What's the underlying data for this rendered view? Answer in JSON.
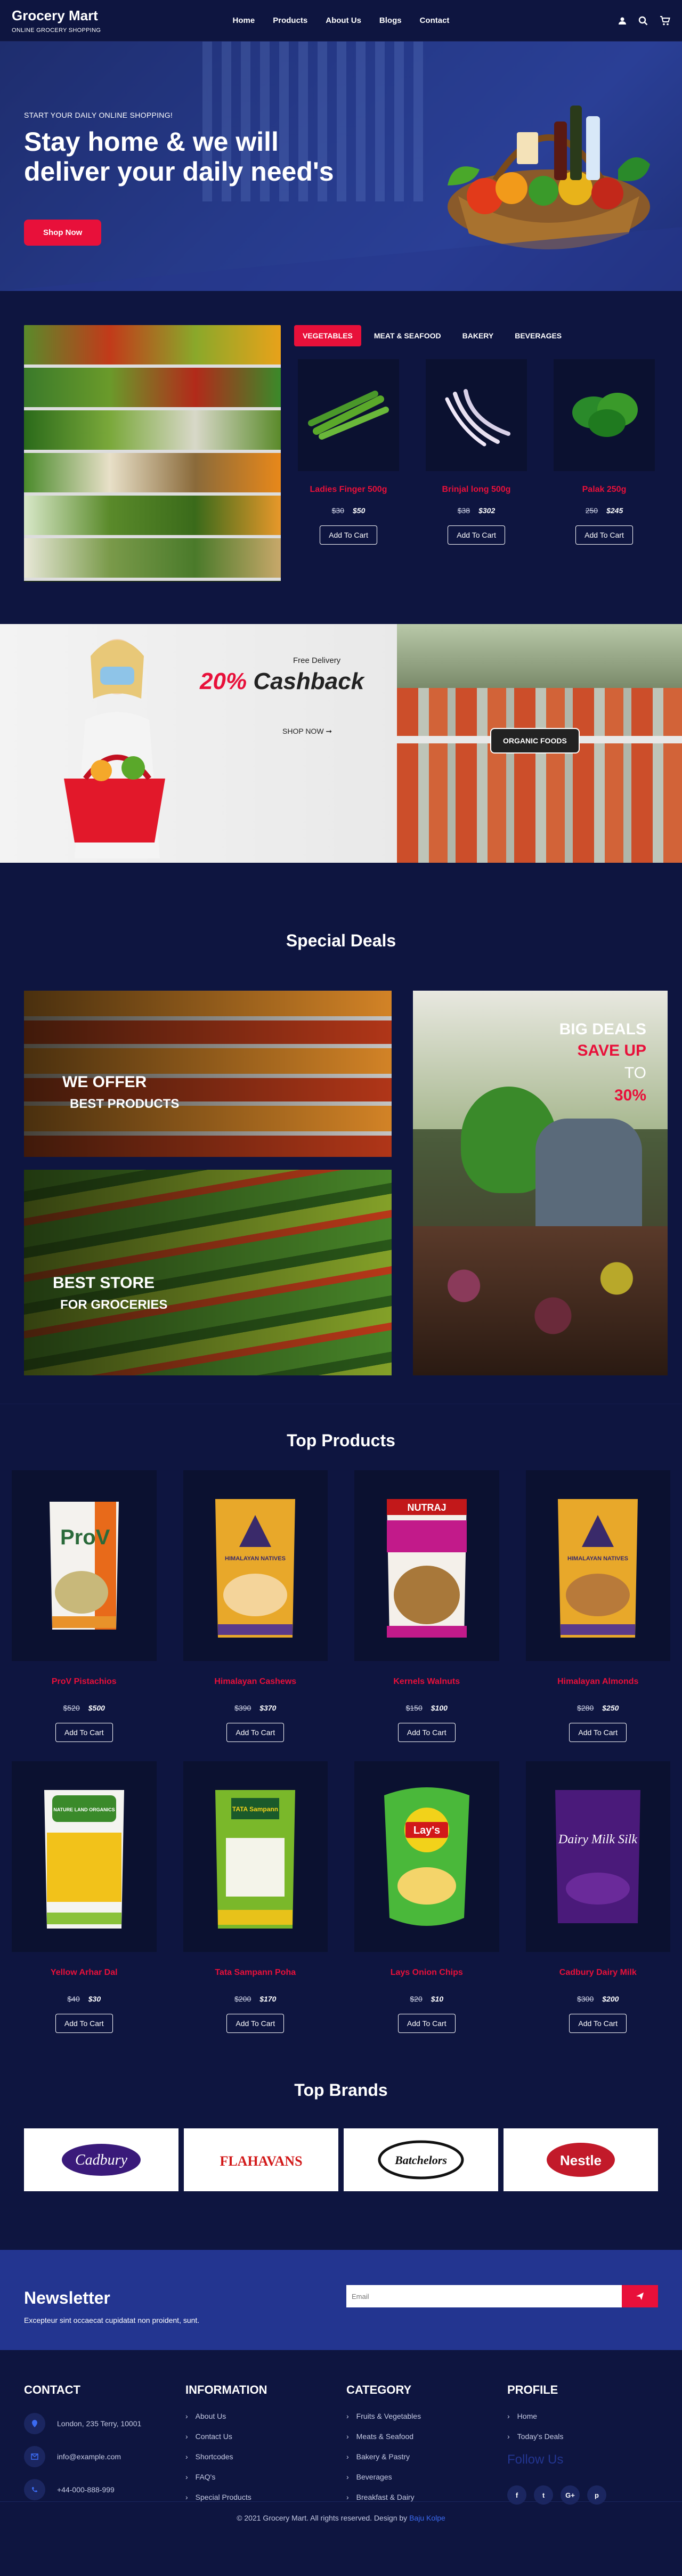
{
  "brand": {
    "name": "Grocery Mart",
    "tagline": "ONLINE GROCERY SHOPPING"
  },
  "nav": {
    "links": [
      "Home",
      "Products",
      "About Us",
      "Blogs",
      "Contact"
    ]
  },
  "icons": {
    "user": "user-icon",
    "search": "search-icon",
    "cart": "cart-icon"
  },
  "hero": {
    "kicker": "Start your daily online shopping!",
    "title": "Stay home & we will deliver your daily need's",
    "button": "Shop Now"
  },
  "category_tabs": {
    "tabs": [
      "VEGETABLES",
      "MEAT & SEAFOOD",
      "BAKERY",
      "BEVERAGES"
    ],
    "active": 0,
    "products": [
      {
        "name": "Ladies Finger 500g",
        "old": "$30",
        "new": "$50",
        "button": "Add To Cart"
      },
      {
        "name": "Brinjal long 500g",
        "old": "$38",
        "new": "$302",
        "button": "Add To Cart"
      },
      {
        "name": "Palak 250g",
        "old": "250",
        "new": "$245",
        "button": "Add To Cart"
      }
    ]
  },
  "promo": {
    "free": "Free Delivery",
    "cashback_pct": "20%",
    "cashback_word": "Cashback",
    "shop": "SHOP NOW",
    "organic": "ORGANIC FOODS"
  },
  "special": {
    "title": "Special Deals",
    "deal1": {
      "line1": "WE OFFER",
      "line2": "BEST PRODUCTS"
    },
    "deal2": {
      "line1": "BEST STORE",
      "line2": "FOR GROCERIES"
    },
    "deal3": {
      "line1": "BIG DEALS",
      "line2": "SAVE UP",
      "line3": "TO",
      "line4": "30%"
    }
  },
  "top_products": {
    "title": "Top Products",
    "items": [
      {
        "name": "ProV Pistachios",
        "old": "$520",
        "new": "$500",
        "button": "Add To Cart",
        "pack": "ProV"
      },
      {
        "name": "Himalayan Cashews",
        "old": "$390",
        "new": "$370",
        "button": "Add To Cart",
        "pack": "HIMALAYAN NATIVES"
      },
      {
        "name": "Kernels Walnuts",
        "old": "$150",
        "new": "$100",
        "button": "Add To Cart",
        "pack": "NUTRAJ"
      },
      {
        "name": "Himalayan Almonds",
        "old": "$280",
        "new": "$250",
        "button": "Add To Cart",
        "pack": "HIMALAYAN NATIVES"
      },
      {
        "name": "Yellow Arhar Dal",
        "old": "$40",
        "new": "$30",
        "button": "Add To Cart",
        "pack": "NATURE LAND ORGANICS"
      },
      {
        "name": "Tata Sampann Poha",
        "old": "$200",
        "new": "$170",
        "button": "Add To Cart",
        "pack": "TATA Sampann"
      },
      {
        "name": "Lays Onion Chips",
        "old": "$20",
        "new": "$10",
        "button": "Add To Cart",
        "pack": "Lay's"
      },
      {
        "name": "Cadbury Dairy Milk",
        "old": "$300",
        "new": "$200",
        "button": "Add To Cart",
        "pack": "Dairy Milk Silk"
      }
    ]
  },
  "top_brands": {
    "title": "Top Brands",
    "items": [
      "Cadbury",
      "FLAHAVANS",
      "Batchelors",
      "Nestle"
    ]
  },
  "newsletter": {
    "title": "Newsletter",
    "sub": "Excepteur sint occaecat cupidatat non proident, sunt.",
    "placeholder": "Email"
  },
  "footer": {
    "contact": {
      "title": "CONTACT",
      "address": "London, 235 Terry, 10001",
      "email": "info@example.com",
      "phone": "+44-000-888-999"
    },
    "information": {
      "title": "INFORMATION",
      "items": [
        "About Us",
        "Contact Us",
        "Shortcodes",
        "FAQ's",
        "Special Products"
      ]
    },
    "category": {
      "title": "CATEGORY",
      "items": [
        "Fruits & Vegetables",
        "Meats & Seafood",
        "Bakery & Pastry",
        "Beverages",
        "Breakfast & Dairy"
      ]
    },
    "profile": {
      "title": "PROFILE",
      "items": [
        "Home",
        "Today's Deals"
      ],
      "follow": "Follow Us",
      "socials": [
        "f",
        "t",
        "G+",
        "p"
      ]
    },
    "copyright": "© 2021 Grocery Mart. All rights reserved. Design by",
    "designer": "Baju Kolpe"
  },
  "colors": {
    "navy": "#0e1540",
    "blue": "#233590",
    "accent": "#e8103a"
  }
}
